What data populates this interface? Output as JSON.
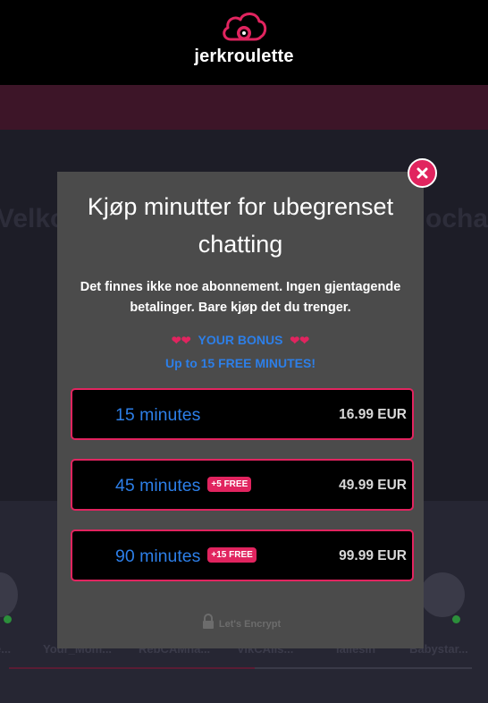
{
  "brand": {
    "name": "jerkroulette"
  },
  "background": {
    "title_left": "Velko",
    "title_right": "ochat",
    "usernames": [
      "e...",
      "Your_Mom...",
      "RebCAMha...",
      "VikCAIls...",
      "lallesin",
      "Babystar..."
    ]
  },
  "modal": {
    "title": "Kjøp minutter for ubegrenset chatting",
    "subtitle": "Det finnes ikke noe abonnement. Ingen gjentagende betalinger. Bare kjøp det du trenger.",
    "bonus_title": "YOUR BONUS",
    "bonus_sub": "Up to 15 FREE MINUTES!",
    "options": [
      {
        "minutes": "15 minutes",
        "badge": "",
        "price": "16.99 EUR"
      },
      {
        "minutes": "45 minutes",
        "badge": "+5 FREE",
        "price": "49.99 EUR"
      },
      {
        "minutes": "90 minutes",
        "badge": "+15 FREE",
        "price": "99.99 EUR"
      }
    ],
    "encrypt": "Let's Encrypt"
  },
  "colors": {
    "accent": "#e1245f",
    "link_blue": "#2d7fe8",
    "modal_bg": "#4b4b4b"
  }
}
